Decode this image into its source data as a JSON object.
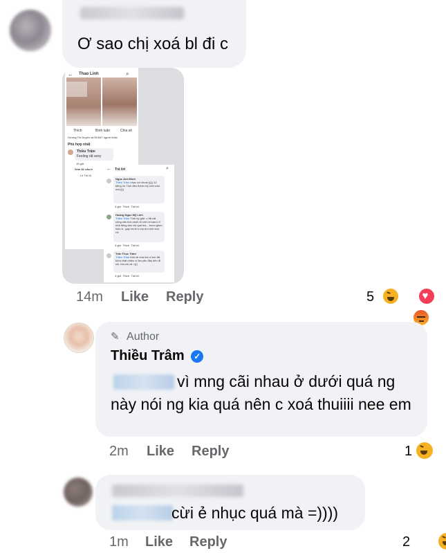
{
  "colors": {
    "meta_gray": "#65676b",
    "bubble": "#f0f2f5",
    "verified_blue": "#1877f2",
    "link_blue": "#216fdb"
  },
  "comment1": {
    "text": "Ơ sao chị xoá bl đi c",
    "time": "14m",
    "like": "Like",
    "reply": "Reply",
    "reaction_count": "5",
    "reactions": [
      "haha-icon",
      "love-icon",
      "angry-icon"
    ],
    "screenshot": {
      "top_title": "Thao Linh",
      "like": "Thích",
      "comment": "Bình luận",
      "share": "Chia sẻ",
      "reaction_text": "Dương Thị Duyên và 50.847 người khác",
      "sort": "Phù hợp nhất",
      "first_name": "Thiều Trâm",
      "first_text": "Feeling rất sexy",
      "first_time": "15 giờ",
      "first_like": "Thích",
      "first_reply": "Trả lời",
      "view_more": "Xem 81 câu tr",
      "reply_preview": "Lê Thị Gi",
      "reply_header": "Trả lời",
      "replies": [
        {
          "name": "Ngọc Ánh Đinh",
          "tag": "Thiều Trâm",
          "text": "nhục vcl chưa:))))) 12 tiếng rồi Tình đéo thèm rep cmt luôn mà:))))",
          "time": "3 giờ",
          "like": "Thích",
          "reply": "Trả lời"
        },
        {
          "name": "Hoàng Ngọc Mỹ Linh",
          "tag": "Thiều Trâm",
          "text": "Tình kỳ ghê. c đã cất công vác tích xanh đi cmt rồi sao k tl một tiếng kéo chị quê kìa... buồn giùm luôn á.. gạp mình k rep là mình xoá rồi",
          "time": "3 giờ",
          "like": "Thích",
          "reply": "Trả lời"
        },
        {
          "name": "Trần Thục Trâm",
          "tag": "Thiều Trâm",
          "text": "thôi về nhà mà vì em đã khóc thật nhiều vì lần yêu đầu tiên đi chị. tha chị oii =)))",
          "time": "4 giờ",
          "like": "Thích",
          "reply": "Trả lời"
        }
      ]
    }
  },
  "comment2": {
    "badge": "Author",
    "name": "Thiều Trâm",
    "text": "vì mng cãi nhau ở dưới quá ng này nói ng kia quá nên c xoá thuiiii nee em",
    "time": "2m",
    "like": "Like",
    "reply": "Reply",
    "reaction_count": "1"
  },
  "comment3": {
    "text": "cừi ẻ nhục quá mà =))))",
    "time": "1m",
    "like": "Like",
    "reply": "Reply",
    "reaction_count": "2"
  }
}
